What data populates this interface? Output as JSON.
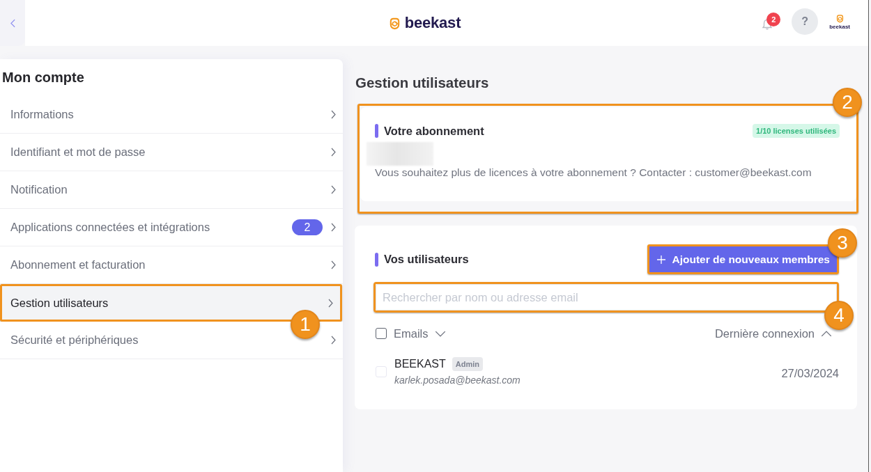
{
  "header": {
    "logo": "beekast",
    "notifications": {
      "count": "2"
    },
    "help_button": {
      "label": "?"
    },
    "account": {
      "logo": "beekast"
    }
  },
  "sidebar": {
    "title": "Mon compte",
    "items": [
      {
        "label": "Informations",
        "selected": false
      },
      {
        "label": "Identifiant et mot de passe",
        "selected": false
      },
      {
        "label": "Notification",
        "selected": false
      },
      {
        "label": "Applications connectées et intégrations",
        "selected": false,
        "badge": "2"
      },
      {
        "label": "Abonnement et facturation",
        "selected": false
      },
      {
        "label": "Gestion utilisateurs",
        "selected": true,
        "callout": "1"
      },
      {
        "label": "Sécurité et périphériques",
        "selected": false
      }
    ]
  },
  "main": {
    "title": "Gestion utilisateurs",
    "subscription": {
      "title": "Votre abonnement",
      "licenses": "1/10 licenses utilisées",
      "message": "Vous souhaitez plus de licences à votre abonnement ? Contacter : customer@beekast.com",
      "callout": "2"
    },
    "users": {
      "title": "Vos utilisateurs",
      "add_button": {
        "label": "Ajouter de nouveaux membres",
        "callout": "3"
      },
      "search": {
        "placeholder": "Rechercher par nom ou adresse email",
        "callout": "4"
      },
      "select_all": {
        "checked": false
      },
      "columns": [
        {
          "label": "Emails",
          "ascending": false
        },
        {
          "label": "Dernière connexion",
          "ascending": true
        }
      ],
      "rows": [
        {
          "name": "BEEKAST",
          "role": "Admin",
          "email": "karlek.posada@beekast.com",
          "last_login": "27/03/2024",
          "checked": false,
          "disabled": true
        }
      ]
    }
  }
}
